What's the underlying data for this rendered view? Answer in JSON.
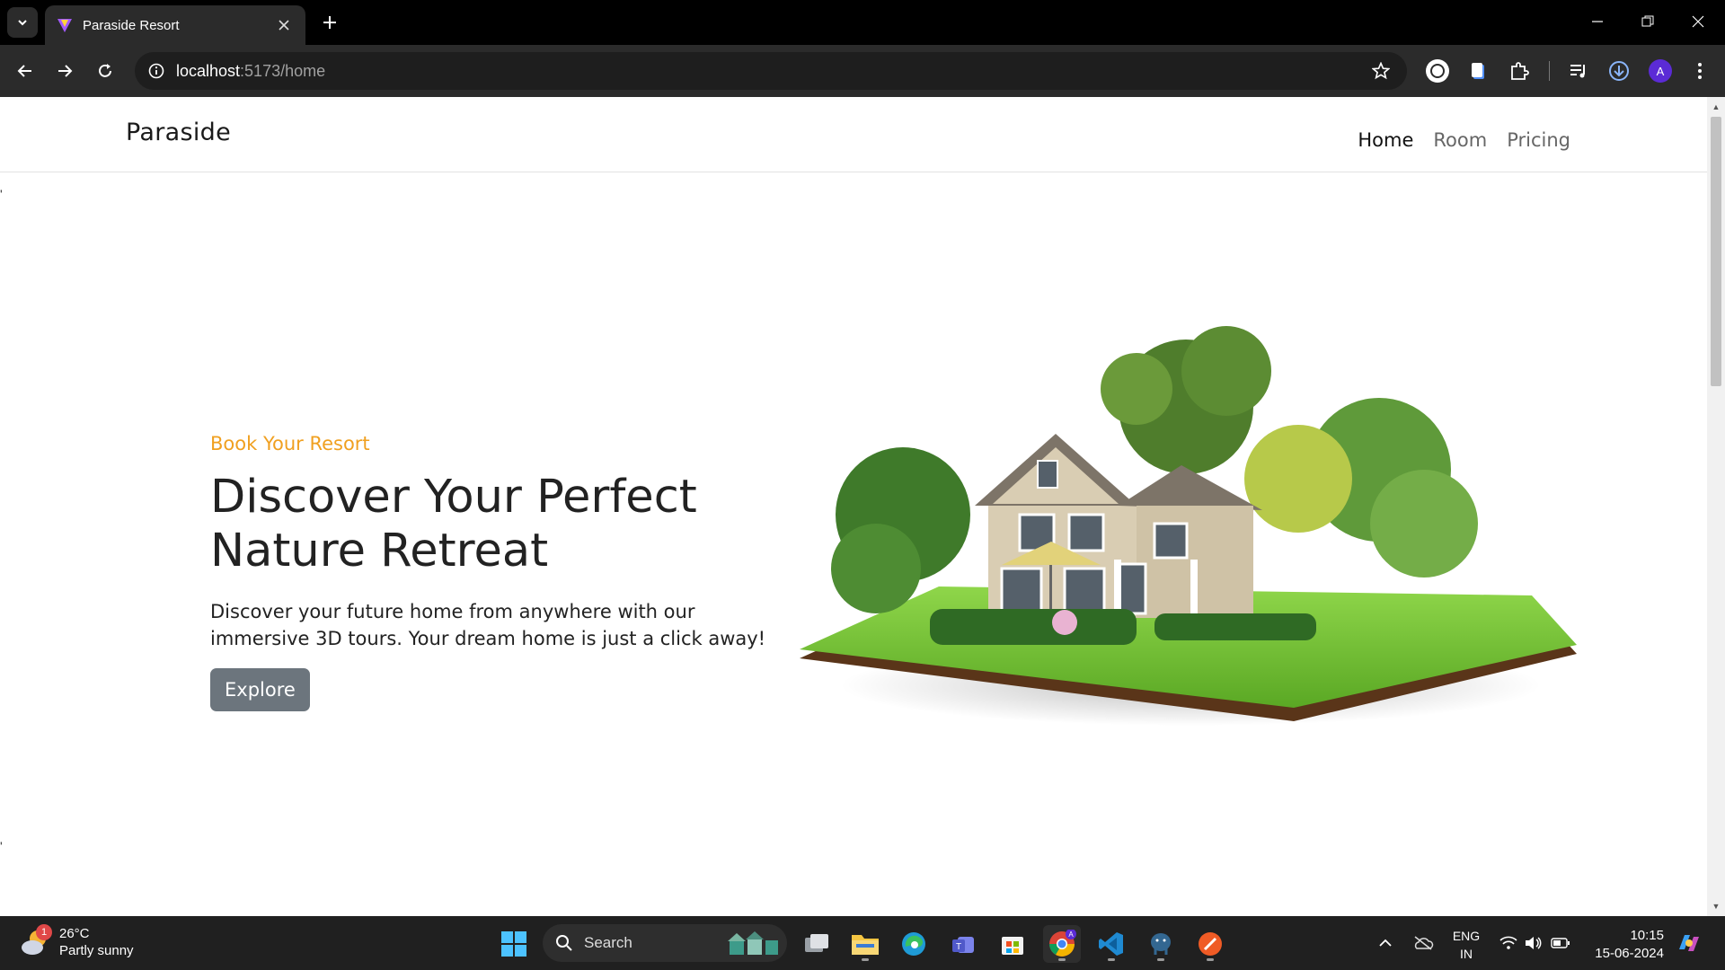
{
  "browser": {
    "tab_title": "Paraside Resort",
    "url_host": "localhost",
    "url_path": ":5173/home"
  },
  "site": {
    "brand": "Paraside",
    "nav": [
      "Home",
      "Room",
      "Pricing"
    ],
    "active_nav": "Home"
  },
  "hero": {
    "eyebrow": "Book Your Resort",
    "headline_line1": "Discover Your Perfect",
    "headline_line2": "Nature Retreat",
    "lead": "Discover your future home from anywhere with our immersive 3D tours. Your dream home is just a click away!",
    "button": "Explore"
  },
  "page_stray_marks": [
    "'",
    "'"
  ],
  "taskbar": {
    "weather_temp": "26°C",
    "weather_desc": "Partly sunny",
    "weather_badge": "1",
    "search_label": "Search",
    "lang_line1": "ENG",
    "lang_line2": "IN",
    "time": "10:15",
    "date": "15-06-2024"
  },
  "colors": {
    "accent": "#f0a020",
    "button_bg": "#6c757d",
    "browser_chrome": "#2b2b2b",
    "taskbar": "#202020"
  },
  "icons": [
    "tab-search-icon",
    "favicon-icon",
    "close-icon",
    "plus-icon",
    "back-icon",
    "forward-icon",
    "reload-icon",
    "site-info-icon",
    "star-icon",
    "extension-icon",
    "profile-avatar",
    "download-icon",
    "menu-icon",
    "windows-start-icon",
    "search-icon",
    "edge-icon",
    "file-explorer-icon",
    "chrome-icon",
    "vscode-icon"
  ]
}
